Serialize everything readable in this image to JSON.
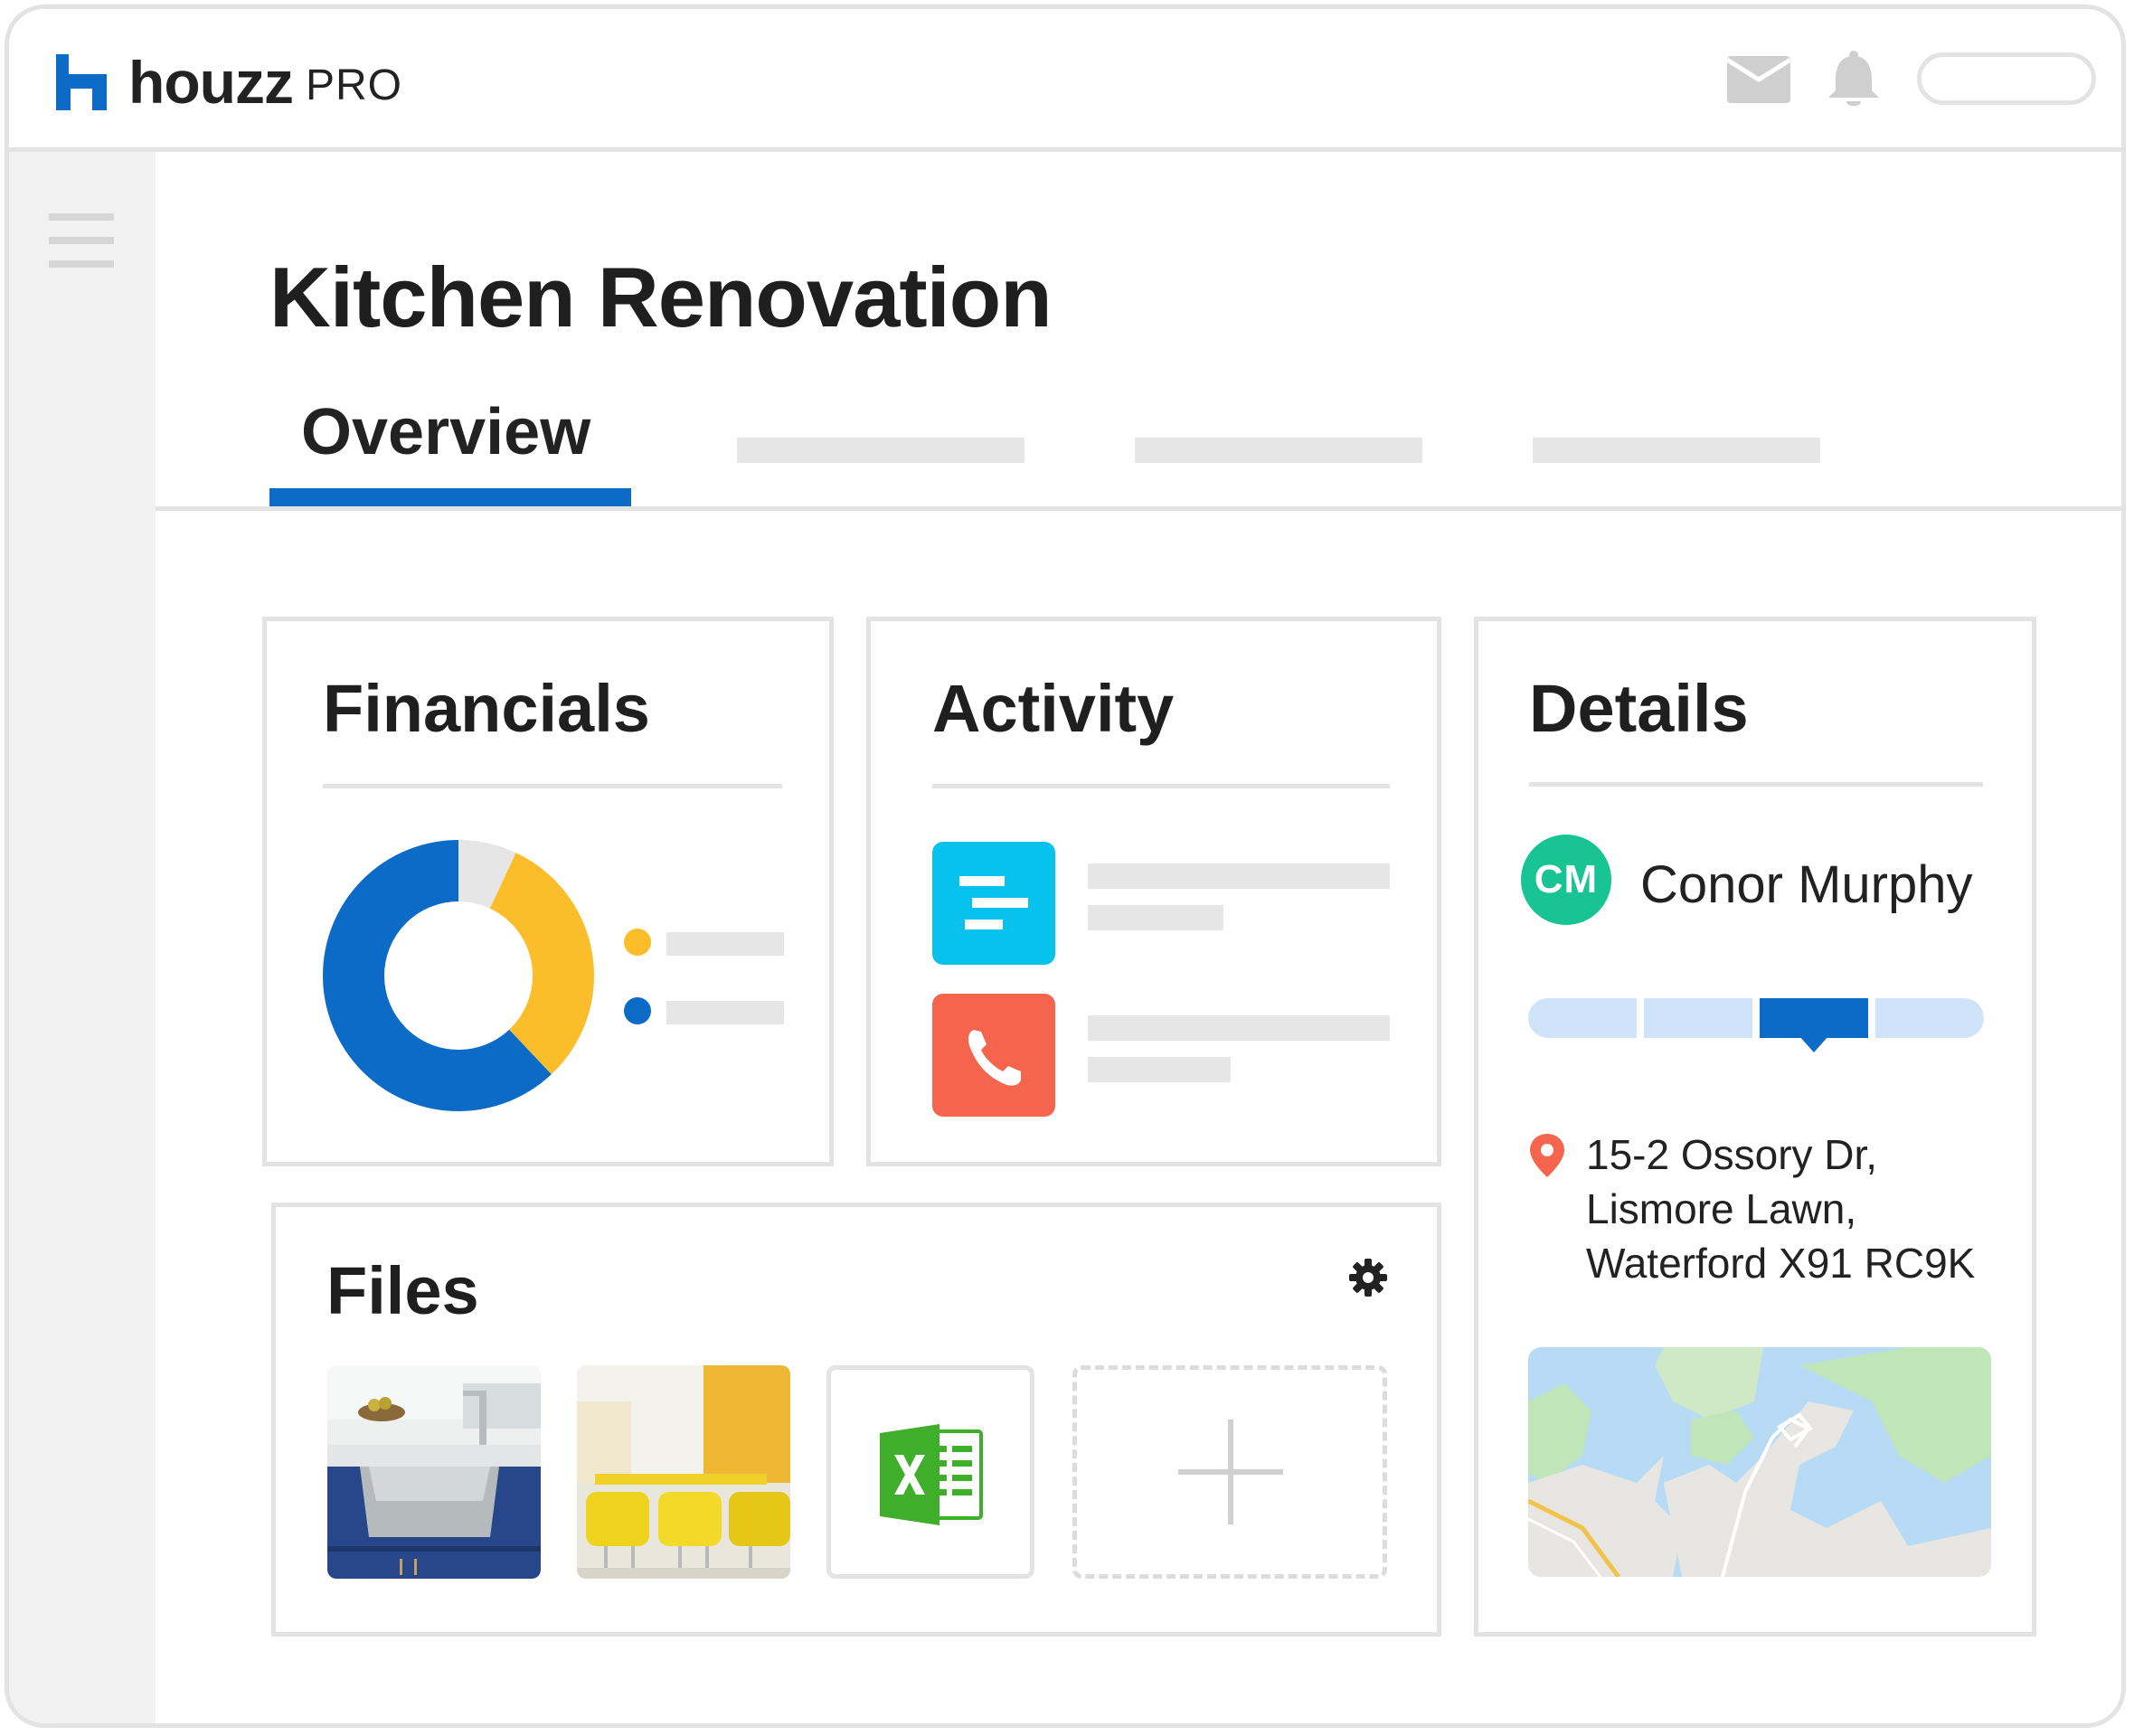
{
  "app": {
    "brand_name": "houzz",
    "brand_suffix": "PRO",
    "brand_color": "#0c6bc6"
  },
  "header": {
    "icons": [
      "mail-icon",
      "bell-icon"
    ]
  },
  "sidebar": {
    "icon": "hamburger-menu-icon"
  },
  "project": {
    "title": "Kitchen Renovation"
  },
  "tabs": {
    "active": "Overview",
    "placeholder_count": 3
  },
  "financials": {
    "title": "Financials",
    "donut": {
      "segments": [
        {
          "color": "#0c6bc6",
          "fraction": 0.62
        },
        {
          "color": "#fbbd2a",
          "fraction": 0.31
        },
        {
          "color": "#e6e6e6",
          "fraction": 0.07
        }
      ]
    },
    "legend_colors": [
      "#fbbd2a",
      "#0c6bc6"
    ]
  },
  "activity": {
    "title": "Activity",
    "items": [
      {
        "icon": "schedule-icon",
        "color": "#08c2ee"
      },
      {
        "icon": "phone-icon",
        "color": "#f5644c"
      }
    ]
  },
  "details": {
    "title": "Details",
    "client": {
      "initials": "CM",
      "name": "Conor Murphy",
      "avatar_color": "#18c394"
    },
    "progress": {
      "stages": 4,
      "current_stage": 3,
      "active_color": "#0c6bc6",
      "inactive_color": "#cfe4f9"
    },
    "address": {
      "line1": "15-2 Ossory Dr,",
      "line2": "Lismore Lawn,",
      "line3": "Waterford X91 RC9K"
    }
  },
  "files": {
    "title": "Files",
    "items": [
      "kitchen-sink-photo",
      "yellow-chairs-photo",
      "excel-file-icon",
      "add-file-button"
    ]
  }
}
